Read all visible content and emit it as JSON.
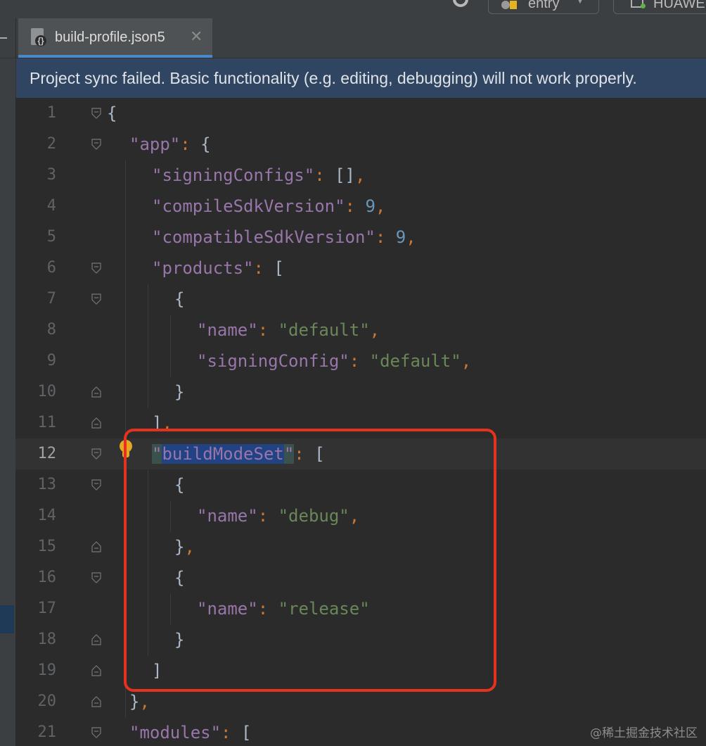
{
  "toolbar": {
    "run_config_label": "entry",
    "device_label": "HUAWEI"
  },
  "tab": {
    "file_name": "build-profile.json5",
    "close_glyph": "✕"
  },
  "banner": {
    "message": "Project sync failed. Basic functionality (e.g. editing, debugging) will not work properly."
  },
  "editor": {
    "current_line": 12,
    "lines": [
      {
        "n": "1"
      },
      {
        "n": "2"
      },
      {
        "n": "3"
      },
      {
        "n": "4"
      },
      {
        "n": "5"
      },
      {
        "n": "6"
      },
      {
        "n": "7"
      },
      {
        "n": "8"
      },
      {
        "n": "9"
      },
      {
        "n": "10"
      },
      {
        "n": "11"
      },
      {
        "n": "12"
      },
      {
        "n": "13"
      },
      {
        "n": "14"
      },
      {
        "n": "15"
      },
      {
        "n": "16"
      },
      {
        "n": "17"
      },
      {
        "n": "18"
      },
      {
        "n": "19"
      },
      {
        "n": "20"
      },
      {
        "n": "21"
      }
    ],
    "code": {
      "app": "\"app\"",
      "signingConfigs": "\"signingConfigs\"",
      "compileSdkVersion": "\"compileSdkVersion\"",
      "compileSdkValue": "9",
      "compatibleSdkVersion": "\"compatibleSdkVersion\"",
      "compatibleSdkValue": "9",
      "products": "\"products\"",
      "name_key": "\"name\"",
      "default_value": "\"default\"",
      "signingConfig": "\"signingConfig\"",
      "buildModeSet": "buildModeSet",
      "debug_value": "\"debug\"",
      "release_value": "\"release\"",
      "modules": "\"modules\""
    }
  },
  "icons": {
    "tab_file": "json5-file-icon",
    "intention": "lightbulb-icon",
    "fold": "fold-marker-icon"
  },
  "colors": {
    "annotation_box": "#e5321e",
    "banner_bg": "#2f4561",
    "tab_underline": "#4a88c7"
  },
  "watermark": "@稀土掘金技术社区"
}
